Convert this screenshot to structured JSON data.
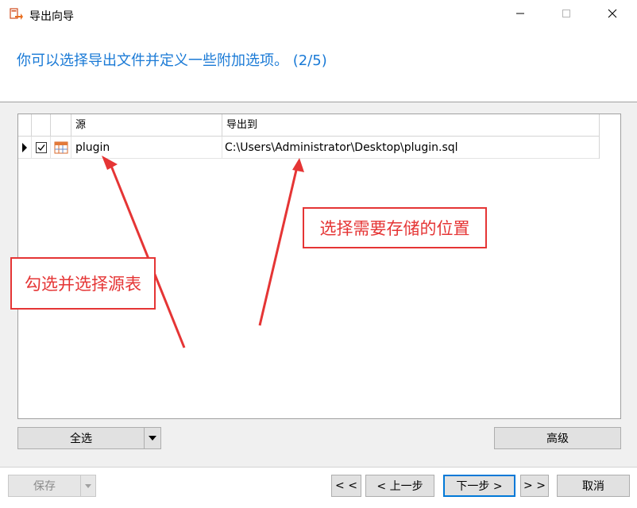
{
  "window": {
    "title": "导出向导",
    "minimize_icon": "minimize-icon",
    "maximize_icon": "maximize-icon",
    "close_icon": "close-icon"
  },
  "wizard": {
    "subtitle": "你可以选择导出文件并定义一些附加选项。 (2/5)"
  },
  "grid": {
    "columns": [
      "源",
      "导出到"
    ],
    "rows": [
      {
        "checked": true,
        "icon": "table-icon",
        "source": "plugin",
        "destination": "C:\\Users\\Administrator\\Desktop\\plugin.sql"
      }
    ]
  },
  "buttons": {
    "select_all": "全选",
    "advanced": "高级",
    "save": "保存",
    "first": "< <",
    "prev": "< 上一步",
    "next": "下一步 >",
    "last": "> >",
    "cancel": "取消"
  },
  "annotations": {
    "source_callout": "勾选并选择源表",
    "dest_callout": "选择需要存储的位置"
  },
  "colors": {
    "subtitle": "#1a7ad6",
    "annotation": "#e53535",
    "focus_border": "#0078d7"
  }
}
